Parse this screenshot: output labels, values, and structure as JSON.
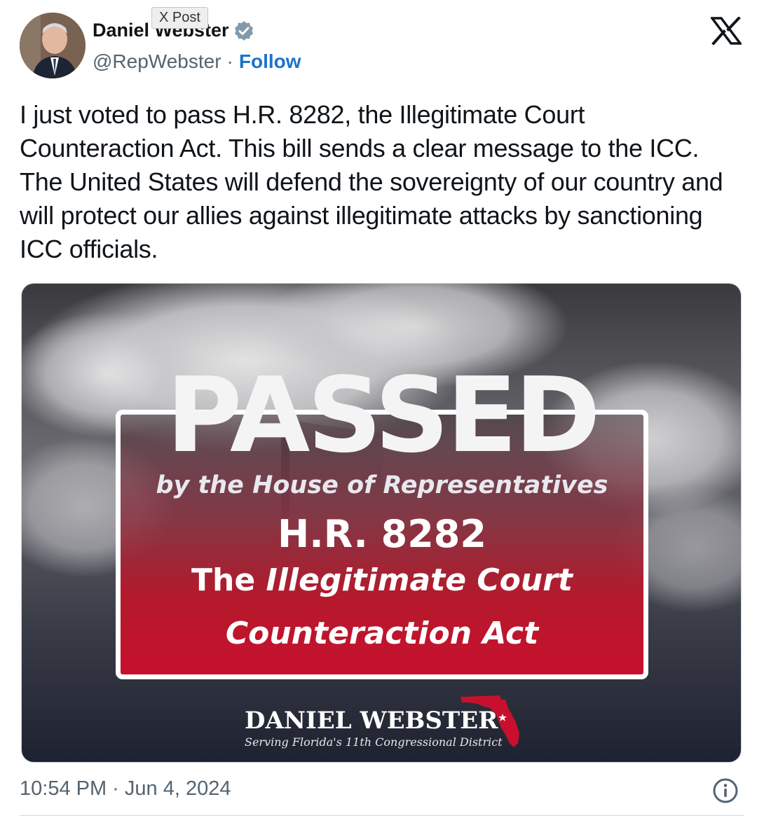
{
  "tooltip": "X Post",
  "author": {
    "display_name": "Daniel Webster",
    "handle": "@RepWebster",
    "separator": "·",
    "follow_label": "Follow",
    "verified_icon": "verified-badge-icon",
    "avatar_icon": "avatar"
  },
  "tweet": {
    "text": "I just voted to pass H.R. 8282, the Illegitimate Court Counteraction Act. This bill sends a clear message to the ICC. The United States will defend the sovereignty of our country and will protect our allies against illegitimate attacks by sanctioning ICC officials."
  },
  "media": {
    "headline": "PASSED",
    "subline": "by the House of Representatives",
    "bill_number": "H.R. 8282",
    "title_prefix": "The ",
    "title_italic": "Illegitimate Court",
    "title_line2": "Counteraction Act",
    "brand_name": "DANIEL WEBSTER",
    "brand_tagline": "Serving Florida's 11th Congressional District",
    "colors": {
      "accent_red": "#c8102e",
      "box_border": "#ffffff"
    }
  },
  "footer": {
    "timestamp": "10:54 PM · Jun 4, 2024",
    "info_icon": "info-icon"
  },
  "x_logo": "x-logo-icon"
}
